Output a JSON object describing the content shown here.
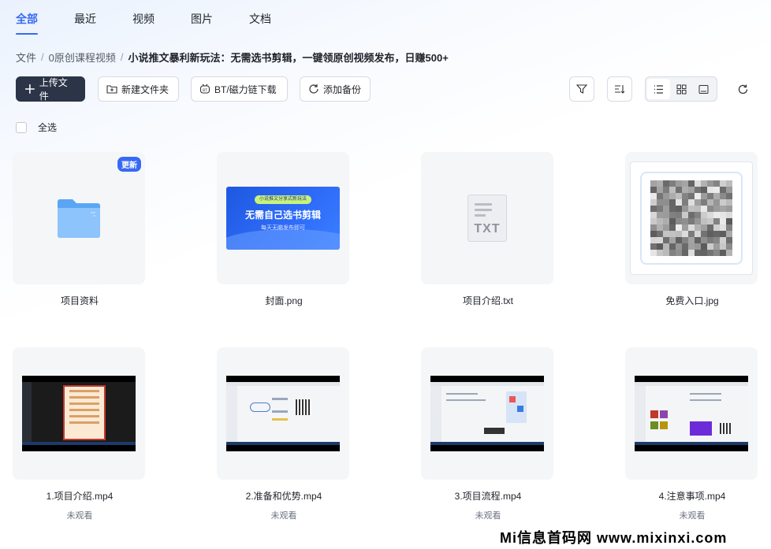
{
  "tabs": [
    {
      "label": "全部",
      "active": true
    },
    {
      "label": "最近"
    },
    {
      "label": "视频"
    },
    {
      "label": "图片"
    },
    {
      "label": "文档"
    }
  ],
  "breadcrumb": {
    "items": [
      "文件",
      "0原创课程视频"
    ],
    "separator": "/",
    "current": "小说推文暴利新玩法：无需选书剪辑，一键领原创视频发布，日赚500+"
  },
  "toolbar": {
    "upload": "上传文件",
    "new_folder": "新建文件夹",
    "bt_download": "BT/磁力链下载",
    "add_backup": "添加备份"
  },
  "select_all_label": "全选",
  "accent_color": "#3869f5",
  "files": [
    {
      "name": "项目资料",
      "type": "folder",
      "badge": "更新"
    },
    {
      "name": "封面.png",
      "type": "image-cover",
      "cover": {
        "pill": "小说推文分享式新玩法",
        "title": "无需自己选书剪辑",
        "subtitle": "每天无脑发布即可"
      }
    },
    {
      "name": "项目介绍.txt",
      "type": "txt",
      "icon_label": "TXT"
    },
    {
      "name": "免费入口.jpg",
      "type": "image-qr"
    },
    {
      "name": "1.项目介绍.mp4",
      "type": "video",
      "status": "未观看"
    },
    {
      "name": "2.准备和优势.mp4",
      "type": "video",
      "status": "未观看"
    },
    {
      "name": "3.项目流程.mp4",
      "type": "video",
      "status": "未观看"
    },
    {
      "name": "4.注意事项.mp4",
      "type": "video",
      "status": "未观看"
    }
  ],
  "watermark": "Mi信息首码网 www.mixinxi.com"
}
